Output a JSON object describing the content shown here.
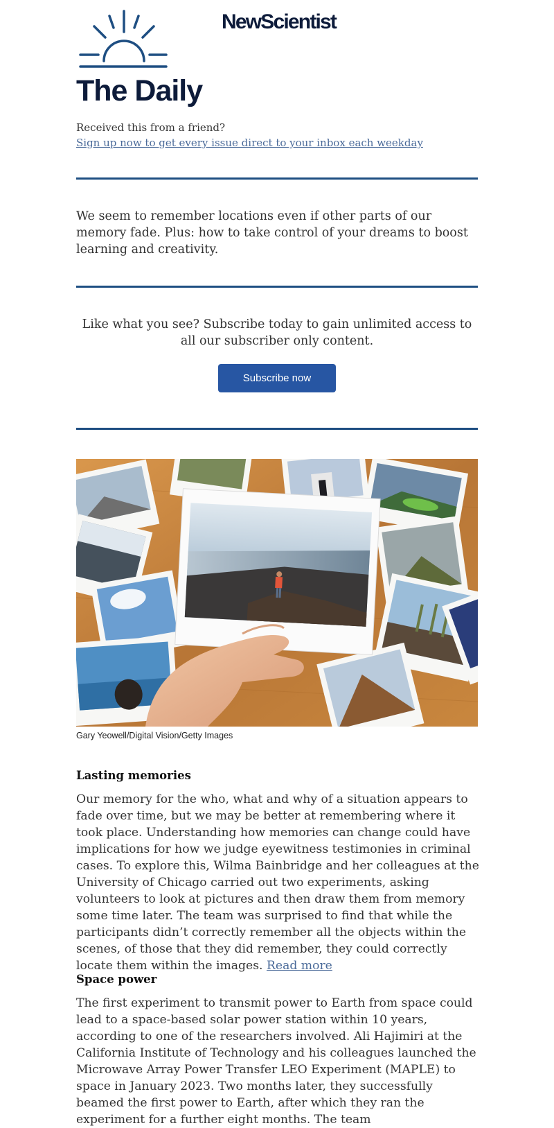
{
  "header": {
    "logo_icon": "sun-rising-icon",
    "brand": "NewScientist",
    "title": "The Daily",
    "friend_text": "Received this from a friend?",
    "signup_link": "Sign up now to get every issue direct to your inbox each weekday"
  },
  "intro": {
    "text": "We seem to remember locations even if other parts of our memory fade. Plus: how to take control of your dreams to boost learning and creativity."
  },
  "promo": {
    "text": "Like what you see? Subscribe today to gain unlimited access to all our subscriber only content.",
    "button_label": "Subscribe now"
  },
  "hero": {
    "credit": "Gary Yeowell/Digital Vision/Getty Images"
  },
  "articles": [
    {
      "heading": "Lasting memories",
      "body": "Our memory for the who, what and why of a situation appears to fade over time, but we may be better at remembering where it took place. Understanding how memories can change could have implications for how we judge eyewitness testimonies in criminal cases. To explore this, Wilma Bainbridge and her colleagues at the University of Chicago carried out two experiments, asking volunteers to look at pictures and then draw them from memory some time later. The team was surprised to find that while the participants didn’t correctly remember all the objects within the scenes, of those that they did remember, they could correctly locate them within the images.",
      "link": "Read more"
    },
    {
      "heading": "Space power",
      "body": "The first experiment to transmit power to Earth from space could lead to a space-based solar power station within 10 years, according to one of the researchers involved. Ali Hajimiri at the California Institute of Technology and his colleagues launched the Microwave Array Power Transfer LEO Experiment (MAPLE) to space in January 2023. Two months later, they successfully beamed the first power to Earth, after which they ran the experiment for a further eight months. The team"
    }
  ],
  "colors": {
    "brand_navy": "#0d1b3a",
    "rule_blue": "#1e4e82",
    "button_blue": "#2756a3",
    "link_blue": "#4a6a99"
  }
}
